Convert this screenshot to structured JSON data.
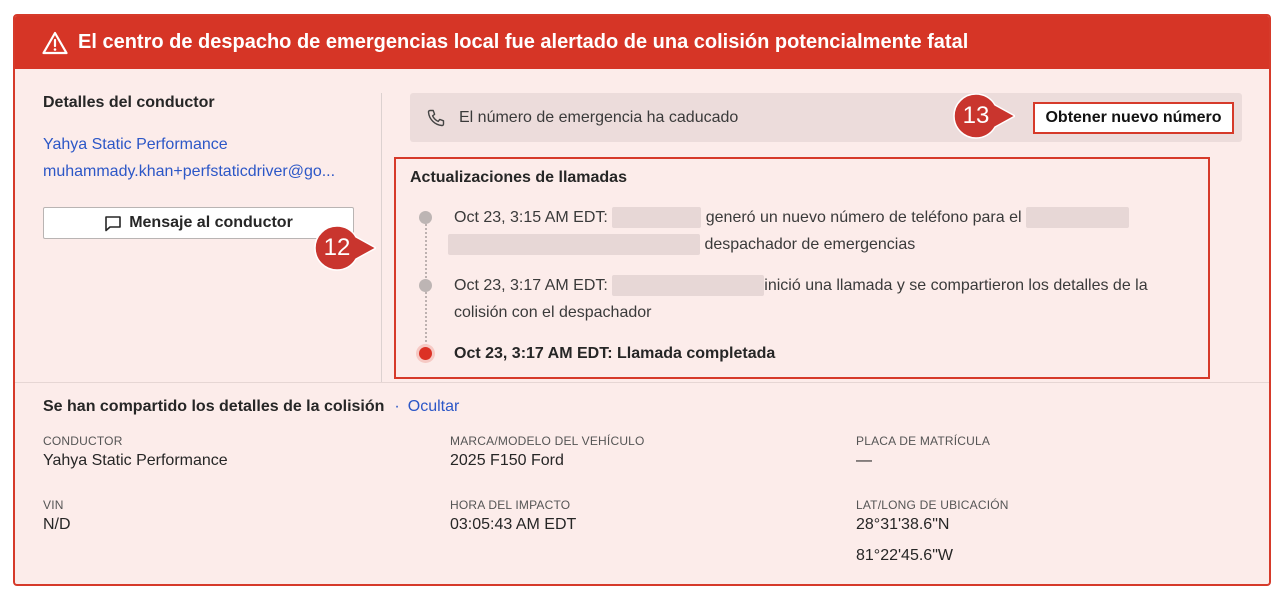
{
  "banner": {
    "title": "El centro de despacho de emergencias local fue alertado de una colisión potencialmente fatal",
    "icon": "warning-triangle-icon",
    "color": "#d63526"
  },
  "driver": {
    "section_title": "Detalles del conductor",
    "name": "Yahya Static Performance",
    "email": "muhammady.khan+perfstaticdriver@go...",
    "message_button": "Mensaje al conductor"
  },
  "emergency_number": {
    "status": "El número de emergencia ha caducado",
    "new_number_button": "Obtener nuevo número"
  },
  "call_updates": {
    "title": "Actualizaciones de llamadas",
    "items": [
      {
        "time": "Oct 23, 3:15 AM EDT:",
        "text_a": "generó un nuevo número de teléfono para el",
        "text_b": "despachador de emergencias"
      },
      {
        "time": "Oct 23, 3:17 AM EDT:",
        "text_a": "inició una llamada y se compartieron los detalles de la",
        "text_b": "colisión con el despachador"
      },
      {
        "text": "Oct 23, 3:17 AM EDT: Llamada completada"
      }
    ]
  },
  "markers": {
    "m12": "12",
    "m13": "13"
  },
  "collision": {
    "title": "Se han compartido los detalles de la colisión",
    "separator": "·",
    "hide_link": "Ocultar",
    "fields": {
      "driver": {
        "label": "CONDUCTOR",
        "value": "Yahya Static Performance"
      },
      "make_model": {
        "label": "MARCA/MODELO DEL VEHÍCULO",
        "value": "2025 F150 Ford"
      },
      "plate": {
        "label": "PLACA DE MATRÍCULA",
        "value": "—"
      },
      "vin": {
        "label": "VIN",
        "value": "N/D"
      },
      "impact_time": {
        "label": "HORA DEL IMPACTO",
        "value": "03:05:43 AM EDT"
      },
      "location": {
        "label": "LAT/LONG DE UBICACIÓN",
        "lat": "28°31'38.6\"N",
        "long": "81°22'45.6\"W"
      }
    }
  }
}
